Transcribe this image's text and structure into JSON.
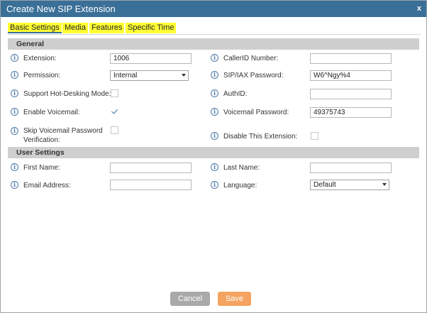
{
  "dialog": {
    "title": "Create New SIP Extension",
    "close_label": "x"
  },
  "tabs": [
    {
      "label": "Basic Settings",
      "active": true
    },
    {
      "label": "Media",
      "active": false
    },
    {
      "label": "Features",
      "active": false
    },
    {
      "label": "Specific Time",
      "active": false
    }
  ],
  "general": {
    "heading": "General",
    "extension": {
      "label": "Extension:",
      "value": "1006"
    },
    "callerid": {
      "label": "CallerID Number:",
      "value": ""
    },
    "permission": {
      "label": "Permission:",
      "value": "Internal"
    },
    "sip_password": {
      "label": "SIP/IAX Password:",
      "value": "W6^Ngy%4"
    },
    "hot_desking": {
      "label": "Support Hot-Desking Mode:",
      "checked": false
    },
    "authid": {
      "label": "AuthID:",
      "value": ""
    },
    "voicemail": {
      "label": "Enable Voicemail:",
      "checked": true
    },
    "voicemail_password": {
      "label": "Voicemail Password:",
      "value": "49375743"
    },
    "skip_vm_password": {
      "label": "Skip Voicemail Password Verification:",
      "checked": false
    },
    "disable_extension": {
      "label": "Disable This Extension:",
      "checked": false
    }
  },
  "user_settings": {
    "heading": "User Settings",
    "first_name": {
      "label": "First Name:",
      "value": ""
    },
    "last_name": {
      "label": "Last Name:",
      "value": ""
    },
    "email": {
      "label": "Email Address:",
      "value": ""
    },
    "language": {
      "label": "Language:",
      "value": "Default"
    }
  },
  "footer": {
    "cancel_label": "Cancel",
    "save_label": "Save"
  },
  "colors": {
    "titlebar": "#3a6f97",
    "tab_highlight": "#ffff33",
    "save": "#f4a460",
    "cancel": "#a9a9a9"
  },
  "icons": {
    "info": "info-circle-icon",
    "checkmark": "checkmark-icon",
    "dropdown": "chevron-down-icon"
  }
}
